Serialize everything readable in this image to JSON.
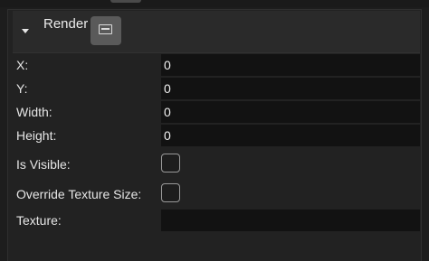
{
  "section": {
    "title": "Render",
    "expand_icon": "caret-down-icon",
    "action_icon": "panel-icon"
  },
  "properties": {
    "x": {
      "label": "X:",
      "value": "0"
    },
    "y": {
      "label": "Y:",
      "value": "0"
    },
    "width": {
      "label": "Width:",
      "value": "0"
    },
    "height": {
      "label": "Height:",
      "value": "0"
    },
    "is_visible": {
      "label": "Is Visible:",
      "checked": false
    },
    "override_texture_size": {
      "label": "Override Texture Size:",
      "checked": false
    },
    "texture": {
      "label": "Texture:",
      "value": ""
    }
  },
  "colors": {
    "background": "#1d1d1d",
    "header": "#2a2a2a",
    "field": "#121212",
    "button": "#5a5a5a",
    "text": "#e6e6e6"
  }
}
